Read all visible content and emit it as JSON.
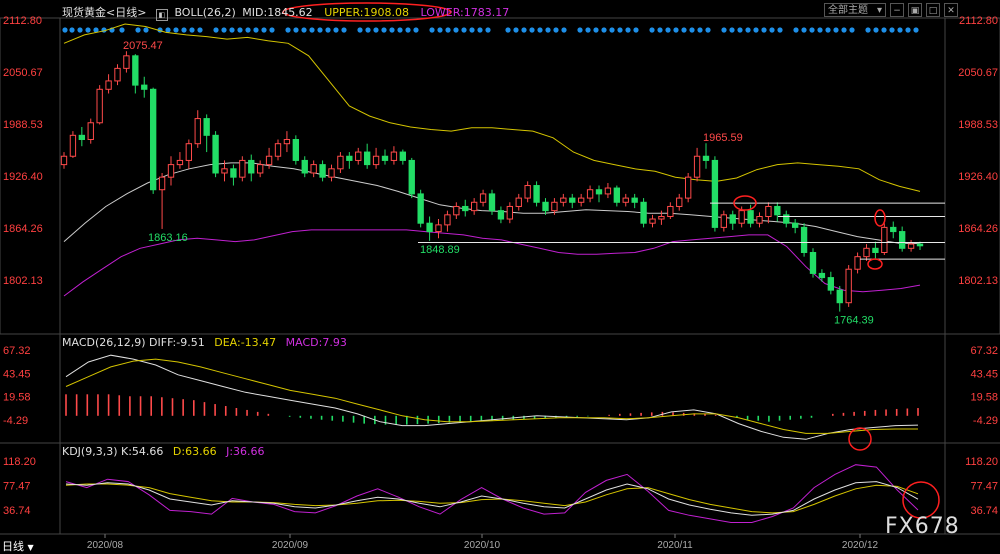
{
  "header": {
    "symbol": "现货黄金<日线>",
    "boll_label": "BOLL(26,2)",
    "mid": "MID:1845.62",
    "upper": "UPPER:1908.08",
    "lower": "LOWER:1783.17",
    "theme_button": "全部主题"
  },
  "macd_header": {
    "name": "MACD(26,12,9)",
    "diff": "DIFF:-9.51",
    "dea": "DEA:-13.47",
    "macd": "MACD:7.93"
  },
  "kdj_header": {
    "name": "KDJ(9,3,3)",
    "k": "K:54.66",
    "d": "D:63.66",
    "j": "J:36.66"
  },
  "period_tab": "日线",
  "watermark": "FX678",
  "colors": {
    "up": "#ff4a4a",
    "down": "#22dd66",
    "upper_band": "#d4c400",
    "lower_band": "#c020d0",
    "mid_band": "#cccccc",
    "annotation": "#ff2020"
  },
  "chart_data": [
    {
      "type": "candlestick",
      "title": "现货黄金<日线>",
      "ylim": [
        1764.39,
        2112.8
      ],
      "yticks": [
        "2112.80",
        "2050.67",
        "1988.53",
        "1926.40",
        "1864.26",
        "1802.13"
      ],
      "xticks": [
        "2020/08",
        "2020/09",
        "2020/10",
        "2020/11",
        "2020/12"
      ],
      "annotations": [
        {
          "label": "2075.47",
          "value": 2075.47
        },
        {
          "label": "1863.16",
          "value": 1863.16
        },
        {
          "label": "1848.89",
          "value": 1848.89
        },
        {
          "label": "1965.59",
          "value": 1965.59
        },
        {
          "label": "1764.39",
          "value": 1764.39
        }
      ],
      "candles": [
        [
          1940,
          1950,
          1935,
          1955
        ],
        [
          1950,
          1975,
          1948,
          1980
        ],
        [
          1975,
          1970,
          1962,
          1985
        ],
        [
          1970,
          1990,
          1965,
          1995
        ],
        [
          1990,
          2030,
          1988,
          2035
        ],
        [
          2030,
          2040,
          2025,
          2048
        ],
        [
          2040,
          2055,
          2035,
          2060
        ],
        [
          2055,
          2070,
          2050,
          2075.47
        ],
        [
          2070,
          2035,
          2025,
          2072
        ],
        [
          2035,
          2030,
          2020,
          2045
        ],
        [
          2030,
          1910,
          1905,
          2032
        ],
        [
          1910,
          1925,
          1863.16,
          1930
        ],
        [
          1925,
          1940,
          1915,
          1950
        ],
        [
          1940,
          1945,
          1935,
          1955
        ],
        [
          1945,
          1965,
          1935,
          1970
        ],
        [
          1965,
          1995,
          1960,
          2005
        ],
        [
          1995,
          1975,
          1955,
          2000
        ],
        [
          1975,
          1930,
          1925,
          1980
        ],
        [
          1930,
          1935,
          1920,
          1945
        ],
        [
          1935,
          1925,
          1915,
          1940
        ],
        [
          1925,
          1945,
          1920,
          1950
        ],
        [
          1945,
          1930,
          1920,
          1952
        ],
        [
          1930,
          1940,
          1925,
          1945
        ],
        [
          1940,
          1950,
          1935,
          1960
        ],
        [
          1950,
          1965,
          1945,
          1970
        ],
        [
          1965,
          1970,
          1955,
          1980
        ],
        [
          1970,
          1945,
          1940,
          1975
        ],
        [
          1945,
          1930,
          1925,
          1950
        ],
        [
          1930,
          1940,
          1925,
          1945
        ],
        [
          1940,
          1925,
          1920,
          1945
        ],
        [
          1925,
          1935,
          1920,
          1940
        ],
        [
          1935,
          1950,
          1930,
          1955
        ],
        [
          1950,
          1945,
          1935,
          1955
        ],
        [
          1945,
          1955,
          1940,
          1960
        ],
        [
          1955,
          1940,
          1935,
          1965
        ],
        [
          1940,
          1950,
          1935,
          1960
        ],
        [
          1950,
          1945,
          1940,
          1958
        ],
        [
          1945,
          1955,
          1940,
          1962
        ],
        [
          1955,
          1945,
          1940,
          1958
        ],
        [
          1945,
          1905,
          1900,
          1948
        ],
        [
          1905,
          1870,
          1865,
          1910
        ],
        [
          1870,
          1860,
          1848.89,
          1878
        ],
        [
          1860,
          1868,
          1852,
          1875
        ],
        [
          1868,
          1880,
          1860,
          1885
        ],
        [
          1880,
          1890,
          1875,
          1895
        ],
        [
          1890,
          1885,
          1878,
          1898
        ],
        [
          1885,
          1895,
          1880,
          1900
        ],
        [
          1895,
          1905,
          1890,
          1910
        ],
        [
          1905,
          1885,
          1880,
          1910
        ],
        [
          1885,
          1875,
          1870,
          1890
        ],
        [
          1875,
          1890,
          1870,
          1895
        ],
        [
          1890,
          1900,
          1885,
          1905
        ],
        [
          1900,
          1915,
          1895,
          1920
        ],
        [
          1915,
          1895,
          1890,
          1920
        ],
        [
          1895,
          1885,
          1880,
          1900
        ],
        [
          1885,
          1895,
          1880,
          1900
        ],
        [
          1895,
          1900,
          1890,
          1905
        ],
        [
          1900,
          1895,
          1888,
          1905
        ],
        [
          1895,
          1900,
          1890,
          1905
        ],
        [
          1900,
          1910,
          1895,
          1915
        ],
        [
          1910,
          1905,
          1895,
          1915
        ],
        [
          1905,
          1912,
          1900,
          1918
        ],
        [
          1912,
          1895,
          1890,
          1915
        ],
        [
          1895,
          1900,
          1890,
          1905
        ],
        [
          1900,
          1895,
          1888,
          1905
        ],
        [
          1895,
          1870,
          1865,
          1900
        ],
        [
          1870,
          1875,
          1865,
          1880
        ],
        [
          1875,
          1878,
          1868,
          1885
        ],
        [
          1878,
          1890,
          1875,
          1895
        ],
        [
          1890,
          1900,
          1885,
          1905
        ],
        [
          1900,
          1925,
          1895,
          1930
        ],
        [
          1925,
          1950,
          1920,
          1960
        ],
        [
          1950,
          1945,
          1935,
          1965.59
        ],
        [
          1945,
          1865,
          1860,
          1950
        ],
        [
          1865,
          1880,
          1860,
          1885
        ],
        [
          1880,
          1870,
          1862,
          1885
        ],
        [
          1870,
          1885,
          1865,
          1890
        ],
        [
          1885,
          1870,
          1865,
          1892
        ],
        [
          1870,
          1878,
          1865,
          1883
        ],
        [
          1878,
          1890,
          1870,
          1895
        ],
        [
          1890,
          1880,
          1872,
          1895
        ],
        [
          1880,
          1870,
          1865,
          1885
        ],
        [
          1870,
          1865,
          1858,
          1875
        ],
        [
          1865,
          1835,
          1830,
          1870
        ],
        [
          1835,
          1810,
          1805,
          1840
        ],
        [
          1810,
          1805,
          1800,
          1815
        ],
        [
          1805,
          1790,
          1785,
          1812
        ],
        [
          1790,
          1775,
          1764.39,
          1795
        ],
        [
          1775,
          1815,
          1770,
          1820
        ],
        [
          1815,
          1830,
          1810,
          1835
        ],
        [
          1830,
          1840,
          1825,
          1845
        ],
        [
          1840,
          1835,
          1828,
          1848
        ],
        [
          1835,
          1865,
          1832,
          1870
        ],
        [
          1865,
          1860,
          1852,
          1872
        ],
        [
          1860,
          1840,
          1836,
          1866
        ],
        [
          1840,
          1845,
          1836,
          1850
        ],
        [
          1845,
          1843,
          1838,
          1848
        ]
      ],
      "upper_band": [
        2085,
        2095,
        2100,
        2108,
        2105,
        2098,
        2095,
        2093,
        2090,
        2092,
        2088,
        2085,
        2070,
        2040,
        2010,
        1998,
        1990,
        1985,
        1982,
        1980,
        1984,
        1984,
        1982,
        1980,
        1972,
        1955,
        1945,
        1940,
        1935,
        1932,
        1925,
        1922,
        1920,
        1924,
        1934,
        1940,
        1942,
        1940,
        1938,
        1935,
        1922,
        1914,
        1908
      ],
      "lower_band": [
        1783,
        1800,
        1815,
        1830,
        1840,
        1845,
        1850,
        1852,
        1850,
        1848,
        1850,
        1855,
        1860,
        1862,
        1862,
        1862,
        1862,
        1862,
        1862,
        1860,
        1858,
        1856,
        1852,
        1850,
        1845,
        1840,
        1835,
        1833,
        1833,
        1834,
        1835,
        1840,
        1848,
        1850,
        1852,
        1854,
        1856,
        1856,
        1842,
        1818,
        1798,
        1790,
        1788,
        1790,
        1792,
        1796
      ],
      "mid_band": [
        1848,
        1870,
        1890,
        1905,
        1918,
        1928,
        1935,
        1940,
        1942,
        1942,
        1938,
        1935,
        1930,
        1925,
        1920,
        1915,
        1908,
        1900,
        1892,
        1888,
        1885,
        1884,
        1882,
        1882,
        1884,
        1886,
        1885,
        1884,
        1882,
        1882,
        1880,
        1878,
        1876,
        1874,
        1872,
        1870,
        1866,
        1860,
        1854,
        1850,
        1846,
        1845.62
      ]
    },
    {
      "type": "bar",
      "title": "MACD(26,12,9)",
      "yticks": [
        "67.32",
        "43.45",
        "19.58",
        "-4.29"
      ],
      "series": [
        {
          "name": "DIFF",
          "values": [
            40,
            55,
            62,
            58,
            52,
            42,
            36,
            30,
            24,
            20,
            16,
            12,
            8,
            2,
            -6,
            -10,
            -10,
            -8,
            -6,
            -4,
            -2,
            0,
            -1,
            -2,
            -3,
            -4,
            -2,
            4,
            6,
            2,
            -8,
            -16,
            -22,
            -24,
            -18,
            -14,
            -12,
            -10,
            -9.51
          ]
        },
        {
          "name": "DEA",
          "values": [
            30,
            40,
            50,
            56,
            58,
            55,
            50,
            44,
            38,
            32,
            26,
            22,
            18,
            12,
            6,
            0,
            -4,
            -6,
            -6,
            -5,
            -4,
            -3,
            -2,
            -2,
            -2,
            -3,
            -2,
            0,
            2,
            2,
            -2,
            -8,
            -14,
            -18,
            -18,
            -16,
            -14,
            -13.5,
            -13.47
          ]
        },
        {
          "name": "MACD",
          "values": [
            22,
            22,
            22,
            20,
            20,
            18,
            16,
            12,
            8,
            4,
            0,
            -2,
            -4,
            -6,
            -8,
            -9,
            -9,
            -8,
            -7,
            -6,
            -5,
            -4,
            -3,
            -2,
            -1,
            0,
            2,
            3,
            4,
            3,
            2,
            0,
            -4,
            -6,
            -4,
            -2,
            2,
            4,
            6,
            7,
            7.93
          ]
        }
      ]
    },
    {
      "type": "line",
      "title": "KDJ(9,3,3)",
      "yticks": [
        "118.20",
        "77.47",
        "36.74"
      ],
      "series": [
        {
          "name": "K",
          "values": [
            80,
            78,
            82,
            80,
            70,
            55,
            50,
            45,
            52,
            50,
            48,
            42,
            40,
            45,
            52,
            58,
            55,
            48,
            42,
            50,
            60,
            55,
            48,
            42,
            40,
            55,
            70,
            80,
            72,
            55,
            45,
            38,
            32,
            28,
            30,
            36,
            55,
            70,
            82,
            84,
            74,
            54.66
          ]
        },
        {
          "name": "D",
          "values": [
            78,
            80,
            80,
            78,
            74,
            64,
            58,
            52,
            50,
            50,
            49,
            46,
            44,
            45,
            48,
            52,
            53,
            51,
            48,
            49,
            54,
            55,
            52,
            48,
            44,
            50,
            62,
            72,
            74,
            64,
            54,
            46,
            40,
            34,
            32,
            34,
            46,
            60,
            72,
            78,
            76,
            63.66
          ]
        },
        {
          "name": "J",
          "values": [
            84,
            74,
            88,
            84,
            62,
            36,
            34,
            30,
            56,
            50,
            46,
            34,
            32,
            44,
            60,
            72,
            58,
            42,
            30,
            54,
            74,
            55,
            40,
            30,
            32,
            66,
            86,
            96,
            68,
            36,
            28,
            22,
            16,
            16,
            26,
            40,
            74,
            96,
            112,
            108,
            70,
            36.66
          ]
        }
      ]
    }
  ]
}
